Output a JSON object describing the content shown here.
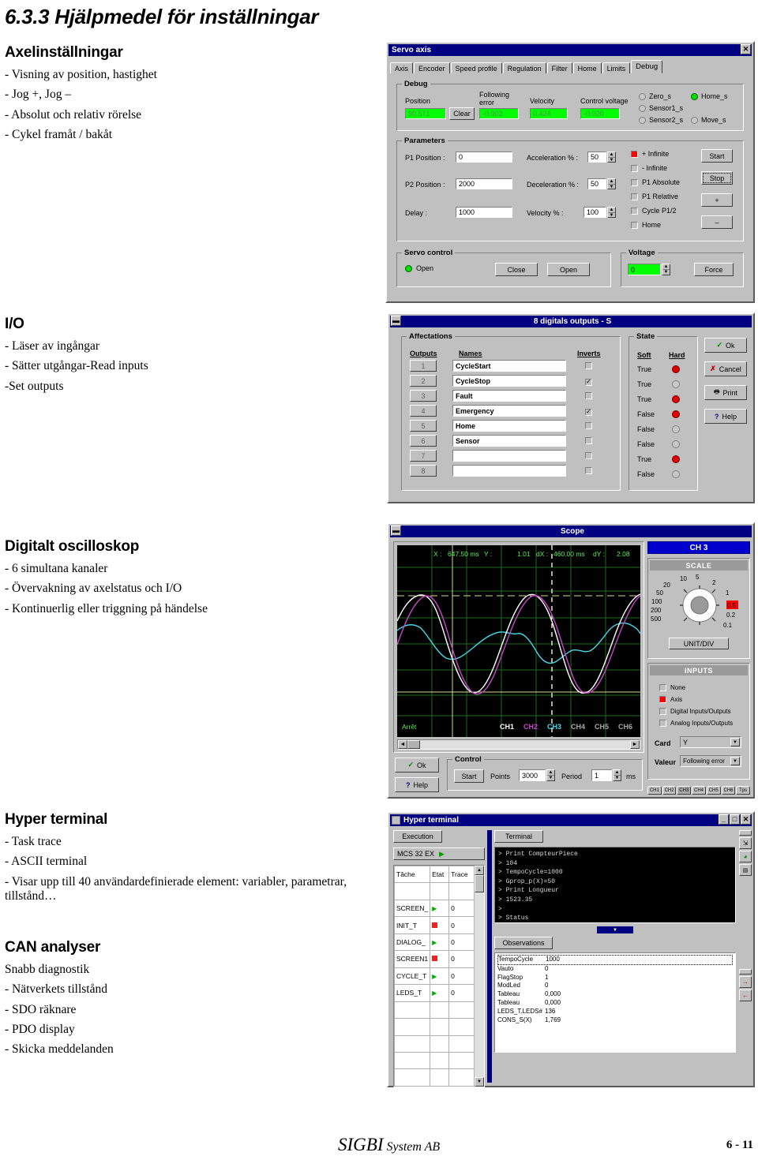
{
  "document": {
    "title": "6.3.3 Hjälpmedel för inställningar",
    "footer": {
      "brand_main": "SIGBI",
      "brand_sub": "System AB",
      "page": "6 - 11"
    }
  },
  "sections": [
    {
      "heading": "Axelinställningar",
      "bullets": [
        "- Visning av position, hastighet",
        "- Jog +, Jog –",
        "- Absolut och relativ rörelse",
        "- Cykel framåt / bakåt"
      ]
    },
    {
      "heading": "I/O",
      "bullets": [
        "- Läser av ingångar",
        "- Sätter utgångar-Read inputs",
        "-Set outputs"
      ]
    },
    {
      "heading": "Digitalt oscilloskop",
      "bullets": [
        "- 6 simultana kanaler",
        "- Övervakning av axelstatus och I/O",
        "- Kontinuerlig eller triggning på händelse"
      ]
    },
    {
      "heading": "Hyper terminal",
      "bullets": [
        "- Task trace",
        "- ASCII terminal",
        "- Visar upp till 40 användardefinierade element: variabler, parametrar, tillstånd…"
      ]
    },
    {
      "heading": "CAN analyser",
      "bullets": [
        "Snabb diagnostik",
        "- Nätverkets tillstånd",
        "- SDO räknare",
        "- PDO display",
        "- Skicka meddelanden"
      ]
    }
  ],
  "servo_axis": {
    "title": "Servo axis",
    "close_label": "✕",
    "tabs": [
      {
        "label": "Axis",
        "active": false
      },
      {
        "label": "Encoder",
        "active": false
      },
      {
        "label": "Speed profile",
        "active": false
      },
      {
        "label": "Regulation",
        "active": false
      },
      {
        "label": "Filter",
        "active": false
      },
      {
        "label": "Home",
        "active": false
      },
      {
        "label": "Limits",
        "active": false
      },
      {
        "label": "Debug",
        "active": true
      }
    ],
    "debug": {
      "group_label": "Debug",
      "position_label": "Position",
      "position_value": "90.571",
      "clear_label": "Clear",
      "following_error_label_1": "Following",
      "following_error_label_2": "error",
      "following_error_value": "-0.002",
      "velocity_label": "Velocity",
      "velocity_value": "0.424",
      "control_voltage_label": "Control voltage",
      "control_voltage_value": "-0.020",
      "indicators": [
        {
          "label": "Zero_s",
          "state": "off"
        },
        {
          "label": "Home_s",
          "state": "green"
        },
        {
          "label": "Sensor1_s",
          "state": "off"
        },
        {
          "label": "Sensor2_s",
          "state": "off"
        },
        {
          "label": "Move_s",
          "state": "off"
        }
      ]
    },
    "parameters": {
      "group_label": "Parameters",
      "p1_position_label": "P1 Position :",
      "p1_position_value": "0",
      "p2_position_label": "P2 Position :",
      "p2_position_value": "2000",
      "delay_label": "Delay :",
      "delay_value": "1000",
      "acceleration_label": "Acceleration % :",
      "acceleration_value": "50",
      "deceleration_label": "Deceleration % :",
      "deceleration_value": "50",
      "velocity_label": "Velocity % :",
      "velocity_value": "100",
      "modes": [
        {
          "label": "+ Infinite",
          "checked": true
        },
        {
          "label": "- Infinite",
          "checked": false
        },
        {
          "label": "P1 Absolute",
          "checked": false
        },
        {
          "label": "P1 Relative",
          "checked": false
        },
        {
          "label": "Cycle P1/2",
          "checked": false
        },
        {
          "label": "Home",
          "checked": false
        }
      ],
      "buttons": [
        "Start",
        "Stop",
        "+",
        "–"
      ]
    },
    "servo_control": {
      "group_label": "Servo control",
      "status_label": "Open",
      "close_button": "Close",
      "open_button": "Open"
    },
    "voltage": {
      "group_label": "Voltage",
      "value": "0",
      "force_button": "Force"
    }
  },
  "digital_outputs": {
    "title": "8 digitals outputs - S",
    "affectations_label": "Affectations",
    "col_outputs": "Outputs",
    "col_names": "Names",
    "col_inverts": "Inverts",
    "state_label": "State",
    "col_soft": "Soft",
    "col_hard": "Hard",
    "rows": [
      {
        "n": "1",
        "name": "CycleStart",
        "invert": false,
        "soft": "True",
        "hard": "red"
      },
      {
        "n": "2",
        "name": "CycleStop",
        "invert": true,
        "soft": "True",
        "hard": "off"
      },
      {
        "n": "3",
        "name": "Fault",
        "invert": false,
        "soft": "True",
        "hard": "red"
      },
      {
        "n": "4",
        "name": "Emergency",
        "invert": true,
        "soft": "False",
        "hard": "red"
      },
      {
        "n": "5",
        "name": "Home",
        "invert": false,
        "soft": "False",
        "hard": "off"
      },
      {
        "n": "6",
        "name": "Sensor",
        "invert": false,
        "soft": "False",
        "hard": "off"
      },
      {
        "n": "7",
        "name": "",
        "invert": false,
        "soft": "True",
        "hard": "red"
      },
      {
        "n": "8",
        "name": "",
        "invert": false,
        "soft": "False",
        "hard": "off"
      }
    ],
    "buttons": [
      {
        "label": "Ok",
        "icon": "check-icon"
      },
      {
        "label": "Cancel",
        "icon": "cross-icon"
      },
      {
        "label": "Print",
        "icon": "printer-icon"
      },
      {
        "label": "Help",
        "icon": "question-icon"
      }
    ]
  },
  "scope": {
    "title": "Scope",
    "readout": {
      "x_label": "X :",
      "x_value": "647.50 ms",
      "y_label": "Y :",
      "y_value": "1.01",
      "dx_label": "dX :",
      "dx_value": "460.00 ms",
      "dy_label": "dY :",
      "dy_value": "2.08"
    },
    "status_label": "Arrêt",
    "channel_legend": [
      "CH1",
      "CH2",
      "CH3",
      "CH4",
      "CH5",
      "CH6"
    ],
    "channel_colors": [
      "#ffffff",
      "#cc44cc",
      "#44d8e8",
      "#b0b0b0",
      "#b0b0b0",
      "#b0b0b0"
    ],
    "active_channel": "CH 3",
    "scale_label": "SCALE",
    "scale_ticks": [
      "500",
      "200",
      "100",
      "50",
      "20",
      "10",
      "5",
      "2",
      "1",
      "0.5",
      "0.2",
      "0.1"
    ],
    "scale_selected": "0.5",
    "unit_div_label": "UNIT/DIV",
    "inputs_label": "INPUTS",
    "input_options": [
      {
        "label": "None",
        "selected": false
      },
      {
        "label": "Axis",
        "selected": true
      },
      {
        "label": "Digital Inputs/Outputs",
        "selected": false
      },
      {
        "label": "Analog Inputs/Outputs",
        "selected": false
      }
    ],
    "card_label": "Card",
    "card_value": "Y",
    "valeur_label": "Valeur",
    "valeur_value": "Following error",
    "tabs": [
      "CH1",
      "CH2",
      "CH3",
      "CH4",
      "CH5",
      "CH6",
      "Tps"
    ],
    "active_tab": "CH3",
    "ok_label": "Ok",
    "help_label": "Help",
    "control_label": "Control",
    "start_label": "Start",
    "points_label": "Points",
    "points_value": "3000",
    "period_label": "Period",
    "period_value": "1",
    "period_unit": "ms"
  },
  "hyper_terminal": {
    "title": "Hyper terminal",
    "min_label": "_",
    "max_label": "□",
    "close_label": "✕",
    "execution_tab": "Execution",
    "terminal_tab": "Terminal",
    "device_label": "MCS 32 EX",
    "task_headers": [
      "Tâche",
      "Etat",
      "Trace"
    ],
    "tasks": [
      {
        "name": "SCREEN_",
        "state": "green",
        "trace": "0"
      },
      {
        "name": "INIT_T",
        "state": "red",
        "trace": "0"
      },
      {
        "name": "DIALOG_",
        "state": "green",
        "trace": "0"
      },
      {
        "name": "SCREEN1",
        "state": "red",
        "trace": "0"
      },
      {
        "name": "CYCLE_T",
        "state": "green",
        "trace": "0"
      },
      {
        "name": "LEDS_T",
        "state": "green",
        "trace": "0"
      }
    ],
    "terminal_lines": [
      "> Print CompteurPiece",
      "> 104",
      "> TempoCycle=1000",
      "> Gprop_p(X)=50",
      "> Print Longueur",
      "> 1523.35",
      ">",
      "> Status"
    ],
    "observations_tab": "Observations",
    "observations": [
      {
        "key": "TempoCycle",
        "value": "1000"
      },
      {
        "key": "Vauto",
        "value": "0"
      },
      {
        "key": "FlagStop",
        "value": "1"
      },
      {
        "key": "ModLed",
        "value": "0"
      },
      {
        "key": "Tableau",
        "value": "0,000"
      },
      {
        "key": "Tableau",
        "value": "0,000"
      },
      {
        "key": "LEDS_T.LEDS#",
        "value": "136"
      },
      {
        "key": "CONS_S(X)",
        "value": "1,769"
      }
    ]
  }
}
